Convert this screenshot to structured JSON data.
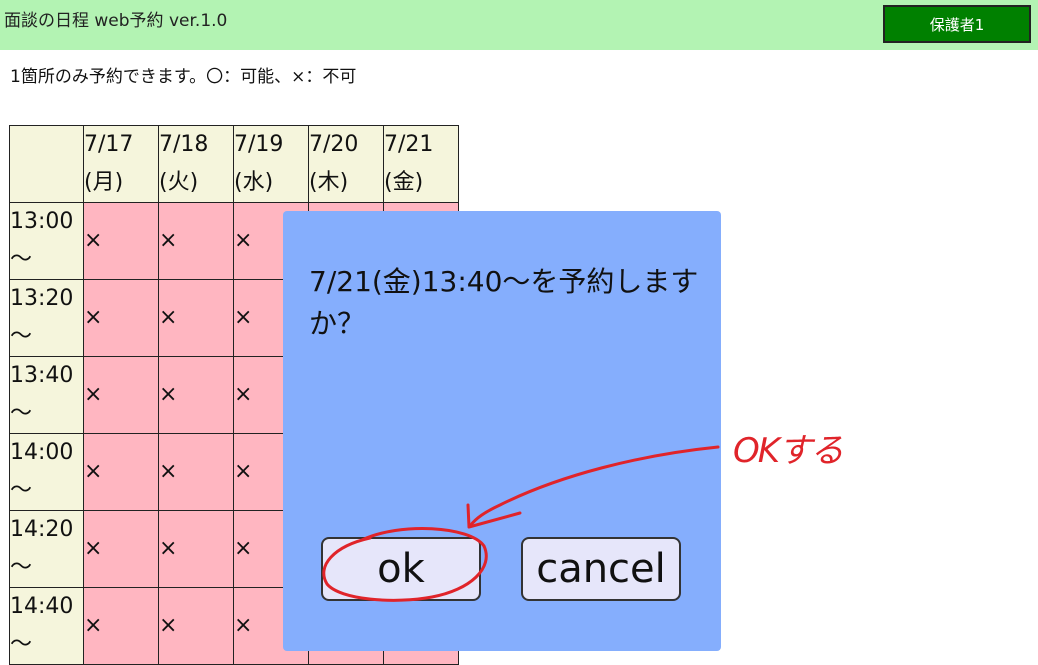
{
  "header": {
    "title": "面談の日程 web予約 ver.1.0",
    "user_label": "保護者1"
  },
  "notice": "1箇所のみ予約できます。〇：可能、×：不可",
  "schedule": {
    "dates": [
      {
        "date": "7/17",
        "day": "(月)"
      },
      {
        "date": "7/18",
        "day": "(火)"
      },
      {
        "date": "7/19",
        "day": "(水)"
      },
      {
        "date": "7/20",
        "day": "(木)"
      },
      {
        "date": "7/21",
        "day": "(金)"
      }
    ],
    "times": [
      "13:00",
      "13:20",
      "13:40",
      "14:00",
      "14:20",
      "14:40"
    ],
    "tilde": "～",
    "mark": "×"
  },
  "dialog": {
    "message": "7/21(金)13:40～を予約しますか？",
    "ok_label": "ok",
    "cancel_label": "cancel"
  },
  "annotation": {
    "text": "OKする",
    "color": "#e0242a"
  }
}
